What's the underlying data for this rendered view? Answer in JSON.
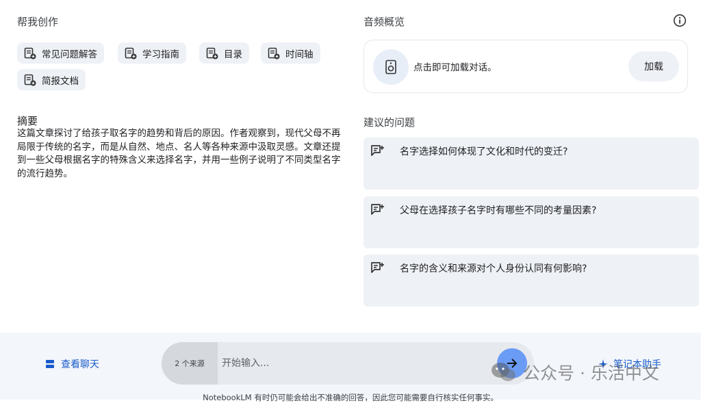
{
  "create": {
    "title": "帮我创作",
    "chips": [
      "常见问题解答",
      "学习指南",
      "目录",
      "时间轴",
      "简报文档"
    ]
  },
  "summary": {
    "title": "摘要",
    "text": "这篇文章探讨了给孩子取名字的趋势和背后的原因。作者观察到，现代父母不再局限于传统的名字，而是从自然、地点、名人等各种来源中汲取灵感。文章还提到一些父母根据名字的特殊含义来选择名字，并用一些例子说明了不同类型名字的流行趋势。"
  },
  "audio": {
    "title": "音频概览",
    "text": "点击即可加载对话。",
    "load_label": "加载"
  },
  "suggested": {
    "title": "建议的问题",
    "questions": [
      "名字选择如何体现了文化和时代的变迁?",
      "父母在选择孩子名字时有哪些不同的考量因素?",
      "名字的含义和来源对个人身份认同有何影响?"
    ]
  },
  "bottom": {
    "view_chat": "查看聊天",
    "source_count": "2 个来源",
    "input_placeholder": "开始输入...",
    "notebook_helper": "笔记本助手",
    "watermark": "公众号 · 乐活中文",
    "disclaimer": "NotebookLM 有时仍可能会给出不准确的回答，因此您可能需要自行核实任何事实。"
  },
  "colors": {
    "accent": "#1a5bc9",
    "send_button": "#6b9cf5",
    "card_bg": "#eef1f5"
  }
}
